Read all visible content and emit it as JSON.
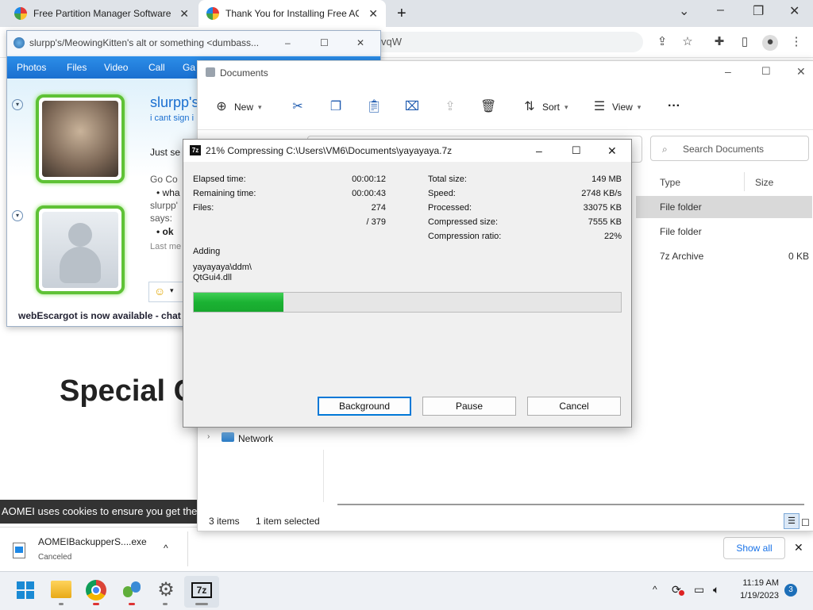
{
  "browser": {
    "tabs": [
      {
        "label": "Free Partition Manager Software"
      },
      {
        "label": "Thank You for Installing Free AOMEI"
      }
    ],
    "new_tab": "+",
    "address_suffix": "vqW",
    "controls": {
      "minimize": "–",
      "restore": "❐",
      "close": "✕",
      "dropdown": "⌄"
    }
  },
  "messenger": {
    "title": "slurpp's/MeowingKitten's alt or something <dumbass...",
    "menu": [
      "Photos",
      "Files",
      "Video",
      "Call",
      "Ga"
    ],
    "name": "slurpp's",
    "status": "i cant sign i",
    "convo": [
      "Just se",
      "Go Co",
      "• wha",
      "slurpp'",
      "says:",
      "• ok",
      "Last me"
    ],
    "footer": "webEscargot is now available - chat w"
  },
  "webpage": {
    "heading": "Special C",
    "cookie": "AOMEI uses cookies to ensure you get the b"
  },
  "download": {
    "file": "AOMEIBackupperS....exe",
    "status": "Canceled",
    "show_all": "Show all"
  },
  "explorer": {
    "title": "Documents",
    "new": "New",
    "sort": "Sort",
    "view": "View",
    "more": "···",
    "search_placeholder": "Search Documents",
    "columns": {
      "type": "Type",
      "size": "Size"
    },
    "rows": [
      {
        "type": "File folder",
        "size": ""
      },
      {
        "type": "File folder",
        "size": ""
      },
      {
        "type": "7z Archive",
        "size": "0 KB"
      }
    ],
    "network": "Network",
    "status_items": "3 items",
    "status_selected": "1 item selected"
  },
  "dialog": {
    "title": "21% Compressing C:\\Users\\VM6\\Documents\\yayayaya.7z",
    "app_icon": "7z",
    "left": [
      {
        "label": "Elapsed time:",
        "value": "00:00:12"
      },
      {
        "label": "Remaining time:",
        "value": "00:00:43"
      },
      {
        "label": "Files:",
        "value": "274"
      },
      {
        "label": "",
        "value": "/ 379"
      }
    ],
    "right": [
      {
        "label": "Total size:",
        "value": "149 MB"
      },
      {
        "label": "Speed:",
        "value": "2748 KB/s"
      },
      {
        "label": "Processed:",
        "value": "33075 KB"
      },
      {
        "label": "Compressed size:",
        "value": "7555 KB"
      },
      {
        "label": "Compression ratio:",
        "value": "22%"
      }
    ],
    "adding_label": "Adding",
    "current_path": "yayayaya\\ddm\\",
    "current_file": "QtGui4.dll",
    "progress_percent": 21,
    "buttons": {
      "background": "Background",
      "pause": "Pause",
      "cancel": "Cancel"
    }
  },
  "taskbar": {
    "time": "11:19 AM",
    "date": "1/19/2023",
    "notifications": "3",
    "zip_label": "7z"
  }
}
